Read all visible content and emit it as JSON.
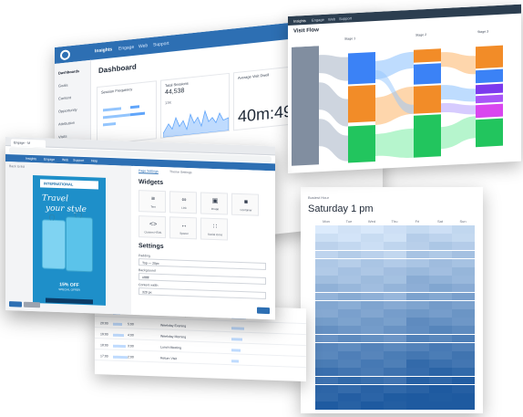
{
  "dashboard": {
    "nav": [
      "Insights",
      "Engage",
      "Web",
      "Support"
    ],
    "sidebar": [
      "Dashboards",
      "Goals",
      "Content",
      "Opportunity",
      "Attribution",
      "Visits"
    ],
    "title": "Dashboard",
    "cards": [
      {
        "title": "Session Frequency"
      },
      {
        "title": "Total Sessions",
        "value": "44,538",
        "sub": "13K"
      },
      {
        "title": "Average Visit Dwell",
        "value": "40m:49s"
      }
    ]
  },
  "flow": {
    "nav": [
      "Insights",
      "Engage",
      "Web",
      "Support"
    ],
    "title": "Visit Flow",
    "stages": [
      "Stage 1",
      "Stage 2",
      "Stage 3"
    ],
    "node_colors": [
      "#3b82f6",
      "#f28c28",
      "#22c55e",
      "#7c3aed",
      "#a855f7",
      "#d946ef",
      "#94a3b8"
    ]
  },
  "heatmap": {
    "label": "Busiest Hour",
    "title": "Saturday 1 pm",
    "days": [
      "Mon",
      "Tue",
      "Wed",
      "Thu",
      "Fri",
      "Sat",
      "Sun"
    ]
  },
  "editor": {
    "tab": "Engage - M",
    "nav": [
      "Insights",
      "Engage",
      "Web",
      "Support",
      "Help"
    ],
    "back": "Back to list",
    "subtabs": [
      "Page Settings",
      "Theme Settings"
    ],
    "widgets_heading": "Widgets",
    "widgets": [
      "Text",
      "Link",
      "Image",
      "Container",
      "Custom HTML",
      "Spacer",
      "Social Icons"
    ],
    "settings_heading": "Settings",
    "settings": [
      {
        "label": "Padding",
        "value": "Top — 20px"
      },
      {
        "label": "Background",
        "value": "#ffffff"
      },
      {
        "label": "Content width",
        "value": "320 px"
      }
    ],
    "ad": {
      "brand": "INTERNATIONAL",
      "headline_1": "Travel",
      "headline_2": "your style",
      "offer": "15% OFF",
      "offer_sub": "SPECIAL OFFER"
    },
    "accent": "#2d6fb3"
  },
  "table": {
    "rows": [
      [
        "21:00",
        "6:00",
        "Weekend Evening"
      ],
      [
        "20:00",
        "5:00",
        "Weekday Evening"
      ],
      [
        "19:00",
        "4:00",
        "Weekday Morning"
      ],
      [
        "18:00",
        "3:00",
        "Lunch Meeting"
      ],
      [
        "17:00",
        "2:00",
        "Return Visit"
      ]
    ]
  }
}
